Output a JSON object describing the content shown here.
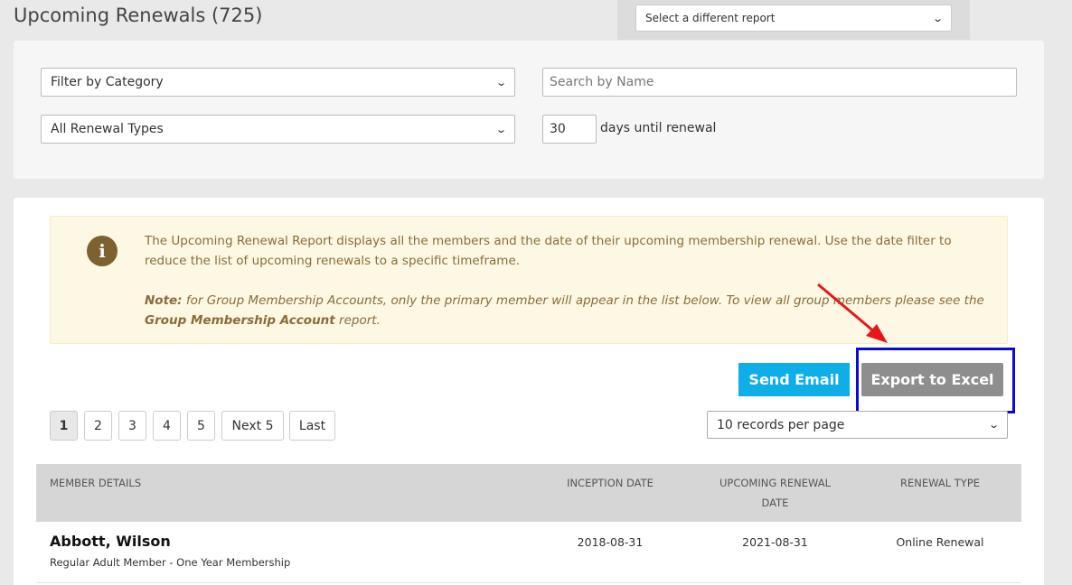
{
  "header": {
    "title": "Upcoming Renewals (725)",
    "report_select": "Select a different report"
  },
  "filters": {
    "category": "Filter by Category",
    "search_placeholder": "Search by Name",
    "renewal_type": "All Renewal Types",
    "days_value": "30",
    "days_label": "days until renewal"
  },
  "info": {
    "text": "The Upcoming Renewal Report displays all the members and the date of their upcoming membership renewal. Use the date filter to reduce the list of upcoming renewals to a specific timeframe.",
    "note_label": "Note:",
    "note_text_1": " for Group Membership Accounts, only the primary member will appear in the list below. To view all group members please see the ",
    "note_link": "Group Membership Account",
    "note_text_2": " report."
  },
  "actions": {
    "send_email": "Send Email",
    "export_excel": "Export to Excel"
  },
  "pagination": {
    "pages": [
      "1",
      "2",
      "3",
      "4",
      "5"
    ],
    "next": "Next 5",
    "last": "Last",
    "per_page": "10 records per page"
  },
  "table": {
    "columns": [
      "MEMBER DETAILS",
      "INCEPTION DATE",
      "UPCOMING RENEWAL",
      "DATE",
      "RENEWAL TYPE"
    ],
    "rows": [
      {
        "name": "Abbott, Wilson",
        "membership": "Regular Adult Member - One Year Membership",
        "inception": "2018-08-31",
        "renewal": "2021-08-31",
        "type": "Online Renewal"
      }
    ]
  },
  "colors": {
    "accent_blue": "#0eaee8",
    "export_gray": "#8e8e8e",
    "annotation_box": "#0a0ad8",
    "annotation_arrow": "#e8161a"
  }
}
